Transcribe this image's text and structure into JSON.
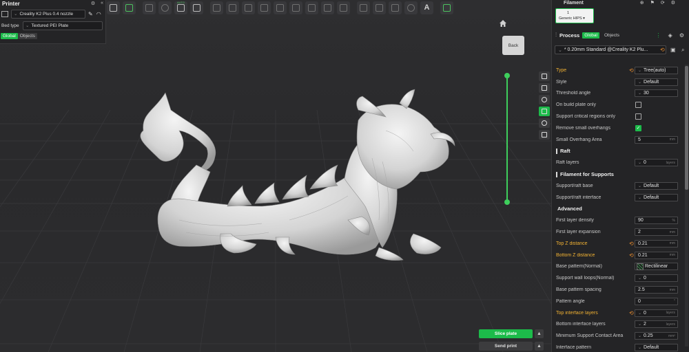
{
  "printer": {
    "title": "Printer",
    "printer_name": "Creality K2 Plus 0.4 nozzle",
    "bed_type_label": "Bed type",
    "bed_type_value": "Textured PEI Plate",
    "tabs": [
      "Global",
      "Objects"
    ]
  },
  "toolbar": {
    "auto_badge": "AUTO",
    "icons": [
      "add-object-icon",
      "add-plate-icon",
      "orient-icon",
      "arrange-icon",
      "auto-orient-icon",
      "split-plate-icon",
      "layer-icon",
      "grid-icon",
      "multi-select-icon",
      "move-icon",
      "rotate-icon",
      "scale-icon",
      "copy-icon",
      "cut-icon",
      "measure-icon",
      "support-paint-icon",
      "seam-paint-icon",
      "color-paint-icon",
      "mesh-boolean-icon",
      "text-icon",
      "assembly-icon"
    ]
  },
  "viewport": {
    "nav_cube_label": "Back",
    "slice_button": "Slice plate",
    "send_button": "Send print"
  },
  "filament": {
    "title": "Filament",
    "slot_number": "1",
    "slot_name": "Generic HIPS"
  },
  "process": {
    "title": "Process",
    "tabs": [
      "Global",
      "Objects"
    ],
    "preset": "* 0.20mm Standard @Creality K2 Plu..."
  },
  "settings": {
    "type": {
      "label": "Type",
      "value": "Tree(auto)"
    },
    "style": {
      "label": "Style",
      "value": "Default"
    },
    "threshold_angle": {
      "label": "Threshold angle",
      "value": "30"
    },
    "on_build_plate": {
      "label": "On build plate only",
      "checked": false
    },
    "critical_regions": {
      "label": "Support critical regions only",
      "checked": false
    },
    "remove_overhangs": {
      "label": "Remove small overhangs",
      "checked": true
    },
    "small_overhang_area": {
      "label": "Small Overhang Area",
      "value": "5",
      "unit": "mm"
    },
    "raft_section": "Raft",
    "raft_layers": {
      "label": "Raft layers",
      "value": "0",
      "unit": "layers"
    },
    "filament_section": "Filament for Supports",
    "support_raft_base": {
      "label": "Support/raft base",
      "value": "Default"
    },
    "support_raft_interface": {
      "label": "Support/raft interface",
      "value": "Default"
    },
    "advanced_section": "Advanced",
    "first_layer_density": {
      "label": "First layer density",
      "value": "90",
      "unit": "%"
    },
    "first_layer_expansion": {
      "label": "First layer expansion",
      "value": "2",
      "unit": "mm"
    },
    "top_z_distance": {
      "label": "Top Z distance",
      "value": "0.21",
      "unit": "mm"
    },
    "bottom_z_distance": {
      "label": "Bottom Z distance",
      "value": "0.21",
      "unit": "mm"
    },
    "base_pattern": {
      "label": "Base pattern(Normal)",
      "value": "Rectilinear"
    },
    "support_wall_loops": {
      "label": "Support wall loops(Normal)",
      "value": "0"
    },
    "base_pattern_spacing": {
      "label": "Base pattern spacing",
      "value": "2.5",
      "unit": "mm"
    },
    "pattern_angle": {
      "label": "Pattern angle",
      "value": "0",
      "unit": "°"
    },
    "top_interface_layers": {
      "label": "Top interface layers",
      "value": "0",
      "unit": "layers"
    },
    "bottom_interface_layers": {
      "label": "Bottom interface layers",
      "value": "2",
      "unit": "layers"
    },
    "min_contact_area": {
      "label": "Minimum Support Contact Area",
      "value": "0.25",
      "unit": "mm²"
    },
    "interface_pattern": {
      "label": "Interface pattern",
      "value": "Default"
    }
  },
  "colors": {
    "accent": "#1cbb4a",
    "changed": "#f2b233",
    "slider": "#3ecf5c"
  }
}
